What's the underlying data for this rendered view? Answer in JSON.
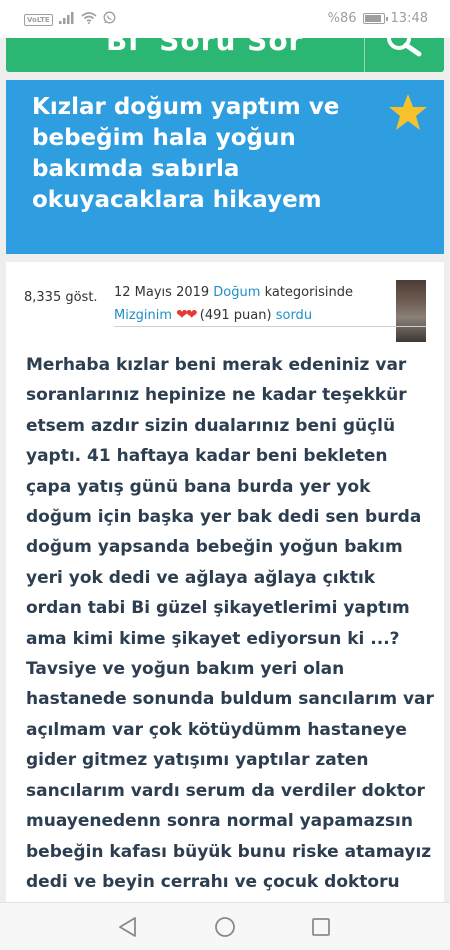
{
  "status_bar": {
    "network_badge": "VoLTE",
    "battery_text": "%86",
    "time": "13:48",
    "icons": [
      "signal-icon",
      "wifi-icon",
      "whatsapp-icon",
      "battery-icon"
    ]
  },
  "header": {
    "site_name": "Bi' Soru Sor",
    "accent_color": "#2bb673",
    "search_icon": "search-icon"
  },
  "question": {
    "title": "Kızlar doğum yaptım ve bebeğim hala yoğun bakımda sabırla okuyacaklara hikayem",
    "card_color": "#2f9ee0",
    "favorite_icon": "star-icon"
  },
  "post_meta": {
    "views": "8,335 göst.",
    "date": "12 Mayıs 2019",
    "category": "Doğum",
    "category_suffix": "kategorisinde",
    "author": "Mizginim",
    "hearts": "❤❤",
    "points": "(491 puan)",
    "action": "sordu"
  },
  "body": {
    "text": "Merhaba kızlar beni merak edeniniz var soranlarınız hepinize ne kadar teşekkür etsem azdır sizin dualarınız beni güçlü yaptı. 41 haftaya kadar beni bekleten çapa yatış günü bana burda yer yok doğum için başka yer bak dedi sen burda doğum yapsanda bebeğin yoğun bakım yeri yok dedi ve ağlaya ağlaya çıktık ordan tabi Bi güzel şikayetlerimi yaptım ama kimi kime şikayet ediyorsun ki ...? Tavsiye ve yoğun bakım yeri olan hastanede sonunda buldum sancılarım var açılmam var çok kötüydümm hastaneye gider gitmez yatışımı yaptılar zaten sancılarım vardı serum da  verdiler doktor muayenedenn sonra normal yapamazsın bebeğin kafası büyük bunu riske atamayız dedi ve beyin cerrahı ve çocuk doktoru"
  },
  "nav_bar": {
    "icons": [
      "back-icon",
      "home-icon",
      "recents-icon"
    ]
  }
}
